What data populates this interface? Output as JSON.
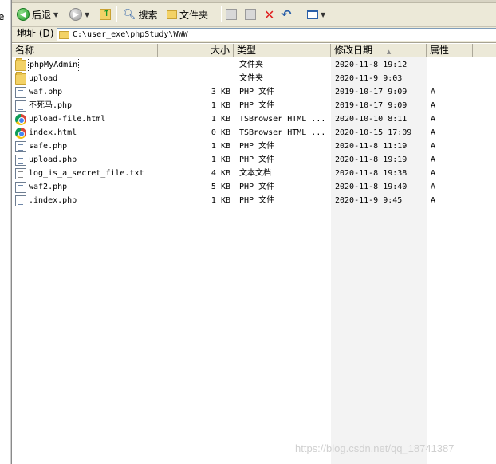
{
  "left_fragment": "e",
  "toolbar": {
    "back_label": "后退",
    "search_label": "搜索",
    "folders_label": "文件夹"
  },
  "address": {
    "label": "地址 (D)",
    "path": "C:\\user_exe\\phpStudy\\WWW"
  },
  "columns": {
    "name": "名称",
    "size": "大小",
    "type": "类型",
    "modified": "修改日期",
    "attributes": "属性"
  },
  "files": [
    {
      "name": "phpMyAdmin",
      "size": "",
      "type": "文件夹",
      "modified": "2020-11-8 19:12",
      "attr": "",
      "icon": "folder"
    },
    {
      "name": "upload",
      "size": "",
      "type": "文件夹",
      "modified": "2020-11-9 9:03",
      "attr": "",
      "icon": "folder"
    },
    {
      "name": "waf.php",
      "size": "3 KB",
      "type": "PHP 文件",
      "modified": "2019-10-17 9:09",
      "attr": "A",
      "icon": "php"
    },
    {
      "name": "不死马.php",
      "size": "1 KB",
      "type": "PHP 文件",
      "modified": "2019-10-17 9:09",
      "attr": "A",
      "icon": "php"
    },
    {
      "name": "upload-file.html",
      "size": "1 KB",
      "type": "TSBrowser HTML ...",
      "modified": "2020-10-10 8:11",
      "attr": "A",
      "icon": "chrome"
    },
    {
      "name": "index.html",
      "size": "0 KB",
      "type": "TSBrowser HTML ...",
      "modified": "2020-10-15 17:09",
      "attr": "A",
      "icon": "chrome"
    },
    {
      "name": "safe.php",
      "size": "1 KB",
      "type": "PHP 文件",
      "modified": "2020-11-8 11:19",
      "attr": "A",
      "icon": "php"
    },
    {
      "name": "upload.php",
      "size": "1 KB",
      "type": "PHP 文件",
      "modified": "2020-11-8 19:19",
      "attr": "A",
      "icon": "php"
    },
    {
      "name": "log_is_a_secret_file.txt",
      "size": "4 KB",
      "type": "文本文档",
      "modified": "2020-11-8 19:38",
      "attr": "A",
      "icon": "txt"
    },
    {
      "name": "waf2.php",
      "size": "5 KB",
      "type": "PHP 文件",
      "modified": "2020-11-8 19:40",
      "attr": "A",
      "icon": "php"
    },
    {
      "name": ".index.php",
      "size": "1 KB",
      "type": "PHP 文件",
      "modified": "2020-11-9 9:45",
      "attr": "A",
      "icon": "php"
    }
  ],
  "watermark": "https://blog.csdn.net/qq_18741387"
}
